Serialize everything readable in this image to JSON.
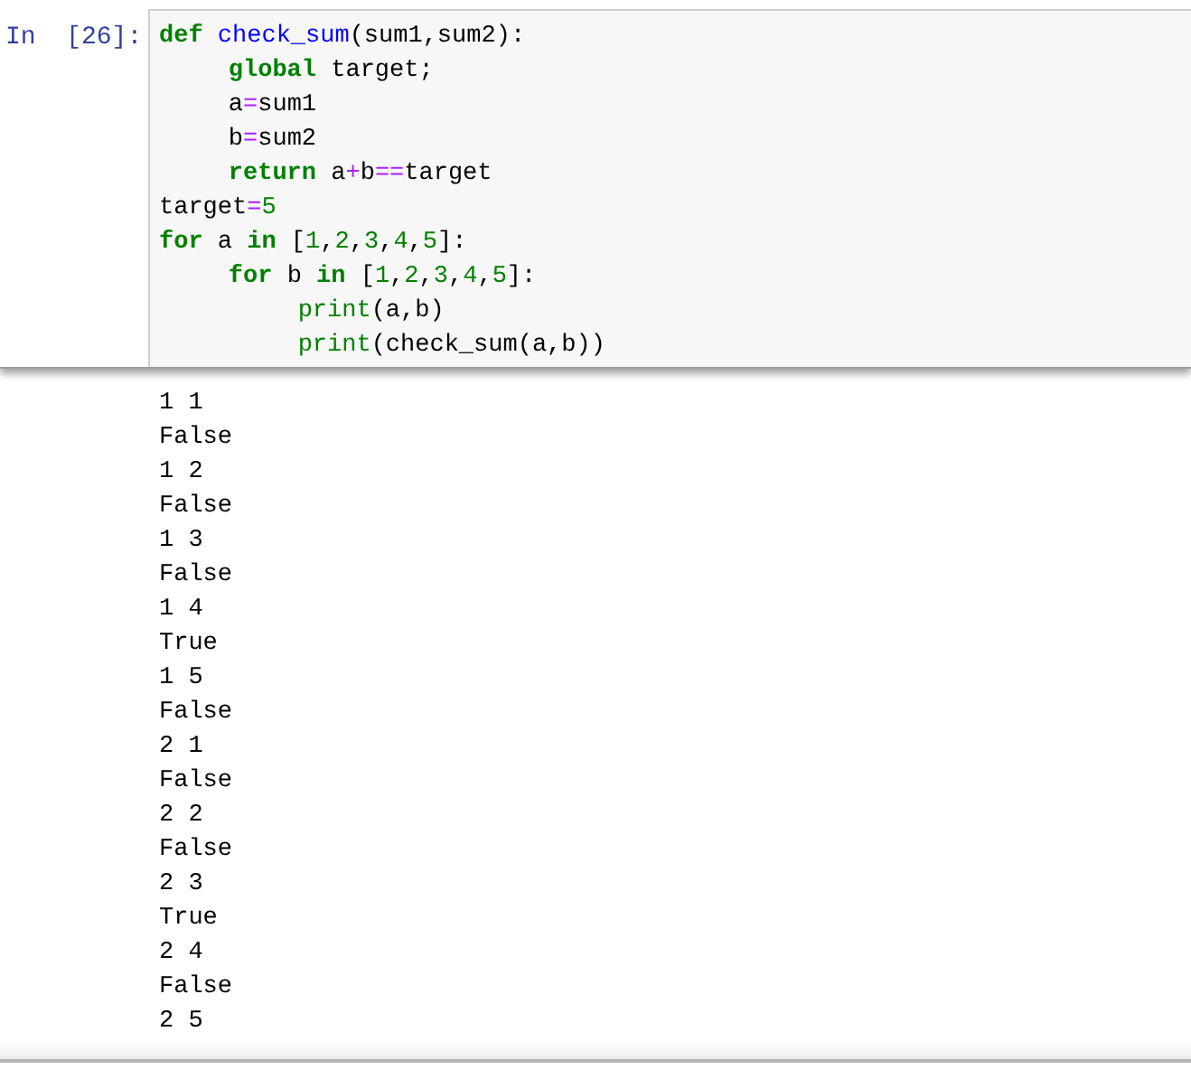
{
  "cell": {
    "prompt": "In  [26]:",
    "code_lines": [
      {
        "tokens": [
          {
            "kind": "kw",
            "text": "def"
          },
          {
            "kind": "name",
            "text": " check_sum"
          },
          {
            "kind": "plain",
            "text": "(sum1,sum2):"
          }
        ],
        "children": [
          {
            "tokens": [
              {
                "kind": "kw",
                "text": "global"
              },
              {
                "kind": "plain",
                "text": " target;"
              }
            ]
          },
          {
            "tokens": [
              {
                "kind": "plain",
                "text": "a"
              },
              {
                "kind": "op",
                "text": "="
              },
              {
                "kind": "plain",
                "text": "sum1"
              }
            ]
          },
          {
            "tokens": [
              {
                "kind": "plain",
                "text": "b"
              },
              {
                "kind": "op",
                "text": "="
              },
              {
                "kind": "plain",
                "text": "sum2"
              }
            ]
          },
          {
            "tokens": [
              {
                "kind": "kw",
                "text": "return"
              },
              {
                "kind": "plain",
                "text": " a"
              },
              {
                "kind": "op",
                "text": "+"
              },
              {
                "kind": "plain",
                "text": "b"
              },
              {
                "kind": "op",
                "text": "=="
              },
              {
                "kind": "plain",
                "text": "target"
              }
            ]
          }
        ]
      },
      {
        "tokens": [
          {
            "kind": "plain",
            "text": "target"
          },
          {
            "kind": "op",
            "text": "="
          },
          {
            "kind": "num",
            "text": "5"
          }
        ]
      },
      {
        "tokens": [
          {
            "kind": "kw",
            "text": "for"
          },
          {
            "kind": "plain",
            "text": " a "
          },
          {
            "kind": "kw",
            "text": "in"
          },
          {
            "kind": "plain",
            "text": " ["
          },
          {
            "kind": "num",
            "text": "1"
          },
          {
            "kind": "plain",
            "text": ","
          },
          {
            "kind": "num",
            "text": "2"
          },
          {
            "kind": "plain",
            "text": ","
          },
          {
            "kind": "num",
            "text": "3"
          },
          {
            "kind": "plain",
            "text": ","
          },
          {
            "kind": "num",
            "text": "4"
          },
          {
            "kind": "plain",
            "text": ","
          },
          {
            "kind": "num",
            "text": "5"
          },
          {
            "kind": "plain",
            "text": "]:"
          }
        ],
        "children": [
          {
            "tokens": [
              {
                "kind": "kw",
                "text": "for"
              },
              {
                "kind": "plain",
                "text": " b "
              },
              {
                "kind": "kw",
                "text": "in"
              },
              {
                "kind": "plain",
                "text": " ["
              },
              {
                "kind": "num",
                "text": "1"
              },
              {
                "kind": "plain",
                "text": ","
              },
              {
                "kind": "num",
                "text": "2"
              },
              {
                "kind": "plain",
                "text": ","
              },
              {
                "kind": "num",
                "text": "3"
              },
              {
                "kind": "plain",
                "text": ","
              },
              {
                "kind": "num",
                "text": "4"
              },
              {
                "kind": "plain",
                "text": ","
              },
              {
                "kind": "num",
                "text": "5"
              },
              {
                "kind": "plain",
                "text": "]:"
              }
            ],
            "children": [
              {
                "tokens": [
                  {
                    "kind": "builtin",
                    "text": "print"
                  },
                  {
                    "kind": "plain",
                    "text": "(a,b)"
                  }
                ]
              },
              {
                "tokens": [
                  {
                    "kind": "builtin",
                    "text": "print"
                  },
                  {
                    "kind": "plain",
                    "text": "(check_sum(a,b))"
                  }
                ]
              }
            ]
          }
        ]
      }
    ]
  },
  "output_lines": [
    "1 1",
    "False",
    "1 2",
    "False",
    "1 3",
    "False",
    "1 4",
    "True",
    "1 5",
    "False",
    "2 1",
    "False",
    "2 2",
    "False",
    "2 3",
    "True",
    "2 4",
    "False",
    "2 5"
  ]
}
